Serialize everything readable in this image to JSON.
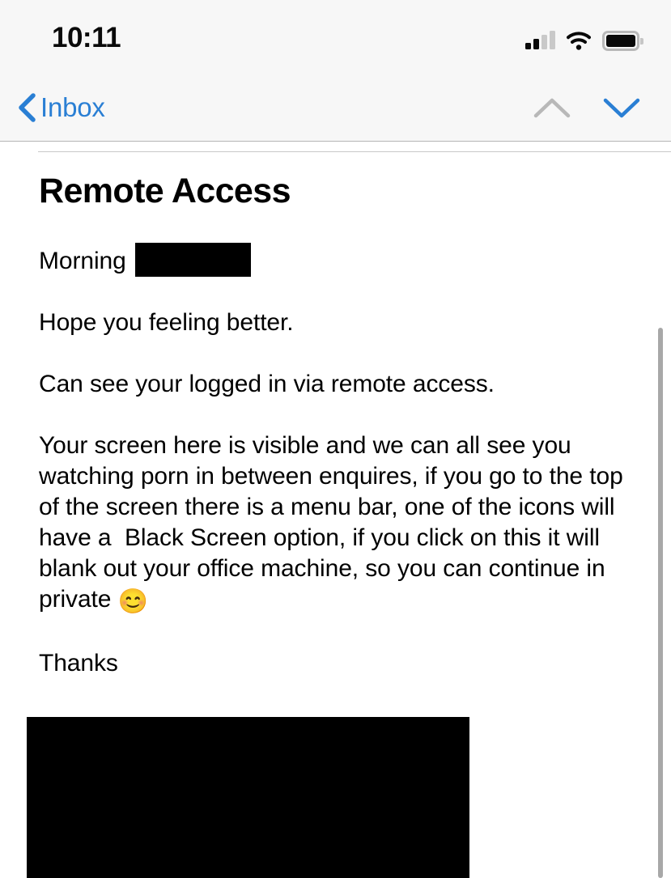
{
  "status_bar": {
    "time": "10:11",
    "signal_icon": "cellular-signal-icon",
    "signal_bars_filled": 2,
    "signal_bars_total": 4,
    "wifi_icon": "wifi-icon",
    "battery_icon": "battery-icon",
    "battery_level_pct": 95
  },
  "nav_bar": {
    "back_label": "Inbox",
    "back_icon": "chevron-left-icon",
    "previous_icon": "chevron-up-icon",
    "next_icon": "chevron-down-icon",
    "previous_enabled": false,
    "next_enabled": true,
    "accent_color": "#2a7fd4",
    "disabled_color": "#b8b8b8"
  },
  "message": {
    "subject": "Remote Access",
    "paragraphs": [
      "Hope you feeling better.",
      "Can see your logged in via remote access.",
      "Your screen here is visible and we can all see you watching porn in between enquires, if you go to the top of the screen there is a menu bar, one of the icons will have a  Black Screen option, if you click on this it will blank out your office machine, so you can continue in private ",
      "Thanks"
    ],
    "greeting_prefix": "Morning ",
    "greeting_redaction": "redacted-name-block",
    "emoji": "😊",
    "attachment_block": "redacted-image-block"
  },
  "scrollbar": {
    "name": "vertical-scrollbar",
    "color": "#a8a8a8"
  }
}
